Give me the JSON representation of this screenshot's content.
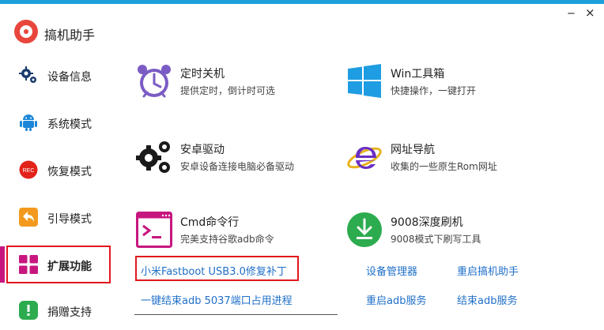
{
  "app": {
    "title": "搞机助手",
    "minimize_glyph": "−",
    "close_glyph": "×"
  },
  "sidebar": {
    "items": [
      {
        "label": "设备信息",
        "icon": "gears-icon"
      },
      {
        "label": "系统模式",
        "icon": "android-icon"
      },
      {
        "label": "恢复模式",
        "icon": "rec-icon"
      },
      {
        "label": "引导模式",
        "icon": "back-arrow-icon"
      },
      {
        "label": "扩展功能",
        "icon": "grid-icon"
      },
      {
        "label": "捐赠支持",
        "icon": "donate-icon"
      }
    ],
    "rec_text": "REC"
  },
  "features": [
    {
      "title": "定时关机",
      "desc": "提供定时，倒计时可选",
      "icon": "alarm-clock-icon",
      "color": "#7b5cc4"
    },
    {
      "title": "Win工具箱",
      "desc": "快捷操作，一键打开",
      "icon": "windows-icon",
      "color": "#1e9de3"
    },
    {
      "title": "安卓驱动",
      "desc": "安卓设备连接电脑必备驱动",
      "icon": "gears-icon",
      "color": "#1a1a1a"
    },
    {
      "title": "网址导航",
      "desc": "收集的一些原生Rom网址",
      "icon": "ie-icon",
      "color": "#6a2fc3"
    },
    {
      "title": "Cmd命令行",
      "desc": "完美支持谷歌adb命令",
      "icon": "terminal-icon",
      "color": "#c7177f"
    },
    {
      "title": "9008深度刷机",
      "desc": "9008模式下刷写工具",
      "icon": "download-icon",
      "color": "#2dab4f"
    }
  ],
  "links": {
    "fastboot": "小米Fastboot USB3.0修复补丁",
    "device_manager": "设备管理器",
    "restart_app": "重启搞机助手",
    "kill_adb": "一键结束adb 5037端口占用进程",
    "restart_adb": "重启adb服务",
    "stop_adb": "结束adb服务"
  },
  "colors": {
    "accent": "#1ea0db",
    "link": "#1f6fc8",
    "highlight_border": "#e2161d",
    "active_indicator": "#c7177f"
  }
}
